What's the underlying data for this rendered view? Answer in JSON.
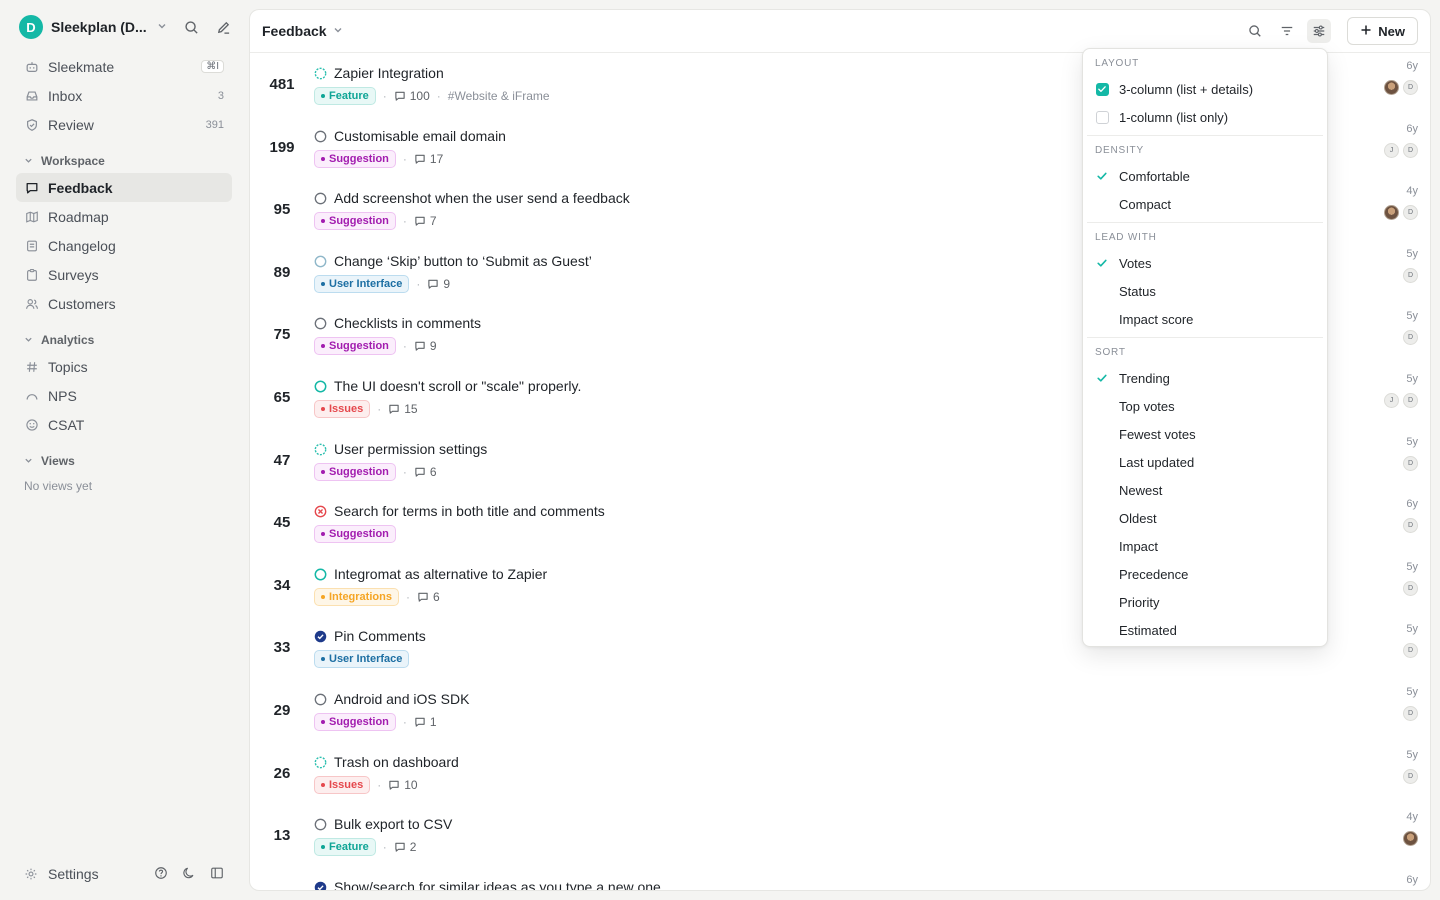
{
  "workspace": {
    "initial": "D",
    "name": "Sleekplan (D..."
  },
  "nav": [
    {
      "label": "Sleekmate",
      "icon": "bot-icon",
      "kbd": "⌘I"
    },
    {
      "label": "Inbox",
      "icon": "inbox-icon",
      "count": "3"
    },
    {
      "label": "Review",
      "icon": "shield-check-icon",
      "count": "391"
    }
  ],
  "sections": {
    "workspace": {
      "label": "Workspace",
      "items": [
        {
          "label": "Feedback",
          "icon": "message-square-icon"
        },
        {
          "label": "Roadmap",
          "icon": "map-icon"
        },
        {
          "label": "Changelog",
          "icon": "layers-icon"
        },
        {
          "label": "Surveys",
          "icon": "clipboard-icon"
        },
        {
          "label": "Customers",
          "icon": "users-icon"
        }
      ]
    },
    "analytics": {
      "label": "Analytics",
      "items": [
        {
          "label": "Topics",
          "icon": "hash-icon"
        },
        {
          "label": "NPS",
          "icon": "gauge-icon"
        },
        {
          "label": "CSAT",
          "icon": "smile-icon"
        }
      ]
    },
    "views": {
      "label": "Views",
      "empty": "No views yet"
    }
  },
  "footer": {
    "settings": "Settings"
  },
  "header": {
    "title": "Feedback",
    "new_label": "New"
  },
  "colors": {
    "accent": "#14b8a6",
    "feature": "#0fb5a3",
    "suggestion": "#b12fc0",
    "ui": "#1f7fb5",
    "issues": "#e5484d",
    "integrations": "#f5a524"
  },
  "rows": [
    {
      "votes": "481",
      "title": "Zapier Integration",
      "status": "open-teal",
      "tag": "Feature",
      "tagType": "feature",
      "comments": "100",
      "topic": "#Website & iFrame",
      "age": "6y",
      "avatars": [
        "photo",
        "D"
      ]
    },
    {
      "votes": "199",
      "title": "Customisable email domain",
      "status": "open-gray",
      "tag": "Suggestion",
      "tagType": "suggestion",
      "comments": "17",
      "age": "6y",
      "avatars": [
        "J",
        "D"
      ]
    },
    {
      "votes": "95",
      "title": "Add screenshot when the user send a feedback",
      "status": "open-gray",
      "tag": "Suggestion",
      "tagType": "suggestion",
      "comments": "7",
      "age": "4y",
      "avatars": [
        "photo",
        "D"
      ]
    },
    {
      "votes": "89",
      "title": "Change ‘Skip’ button to ‘Submit as Guest’",
      "status": "open-light",
      "tag": "User Interface",
      "tagType": "ui",
      "comments": "9",
      "age": "5y",
      "avatars": [
        "D"
      ]
    },
    {
      "votes": "75",
      "title": "Checklists in comments",
      "status": "open-gray",
      "tag": "Suggestion",
      "tagType": "suggestion",
      "comments": "9",
      "age": "5y",
      "avatars": [
        "D"
      ]
    },
    {
      "votes": "65",
      "title": "The UI doesn't scroll or \"scale\" properly.",
      "status": "progress-teal",
      "tag": "Issues",
      "tagType": "issues",
      "comments": "15",
      "age": "5y",
      "avatars": [
        "J",
        "D"
      ]
    },
    {
      "votes": "47",
      "title": "User permission settings",
      "status": "open-teal",
      "tag": "Suggestion",
      "tagType": "suggestion",
      "comments": "6",
      "age": "5y",
      "avatars": [
        "D"
      ]
    },
    {
      "votes": "45",
      "title": "Search for terms in both title and comments",
      "status": "rejected",
      "tag": "Suggestion",
      "tagType": "suggestion",
      "age": "6y",
      "avatars": [
        "D"
      ]
    },
    {
      "votes": "34",
      "title": "Integromat as alternative to Zapier",
      "status": "progress-teal",
      "tag": "Integrations",
      "tagType": "integrations",
      "comments": "6",
      "age": "5y",
      "avatars": [
        "D"
      ]
    },
    {
      "votes": "33",
      "title": "Pin Comments",
      "status": "done",
      "tag": "User Interface",
      "tagType": "ui",
      "age": "5y",
      "avatars": [
        "D"
      ]
    },
    {
      "votes": "29",
      "title": "Android and iOS SDK",
      "status": "open-gray",
      "tag": "Suggestion",
      "tagType": "suggestion",
      "comments": "1",
      "age": "5y",
      "avatars": [
        "D"
      ]
    },
    {
      "votes": "26",
      "title": "Trash on dashboard",
      "status": "open-teal",
      "tag": "Issues",
      "tagType": "issues",
      "comments": "10",
      "age": "5y",
      "avatars": [
        "D"
      ]
    },
    {
      "votes": "13",
      "title": "Bulk export to CSV",
      "status": "open-gray",
      "tag": "Feature",
      "tagType": "feature",
      "comments": "2",
      "age": "4y",
      "avatars": [
        "photo"
      ]
    },
    {
      "votes": "",
      "title": "Show/search for similar ideas as you type a new one",
      "status": "done",
      "age": "6y",
      "avatars": []
    }
  ],
  "dropdown": {
    "layout": {
      "label": "LAYOUT",
      "items": [
        {
          "label": "3-column (list + details)",
          "checked": true
        },
        {
          "label": "1-column (list only)",
          "checked": false
        }
      ]
    },
    "density": {
      "label": "DENSITY",
      "items": [
        {
          "label": "Comfortable",
          "selected": true
        },
        {
          "label": "Compact",
          "selected": false
        }
      ]
    },
    "lead": {
      "label": "LEAD WITH",
      "items": [
        {
          "label": "Votes",
          "selected": true
        },
        {
          "label": "Status",
          "selected": false
        },
        {
          "label": "Impact score",
          "selected": false
        }
      ]
    },
    "sort": {
      "label": "SORT",
      "items": [
        {
          "label": "Trending",
          "selected": true
        },
        {
          "label": "Top votes",
          "selected": false
        },
        {
          "label": "Fewest votes",
          "selected": false
        },
        {
          "label": "Last updated",
          "selected": false
        },
        {
          "label": "Newest",
          "selected": false
        },
        {
          "label": "Oldest",
          "selected": false
        },
        {
          "label": "Impact",
          "selected": false
        },
        {
          "label": "Precedence",
          "selected": false
        },
        {
          "label": "Priority",
          "selected": false
        },
        {
          "label": "Estimated",
          "selected": false
        }
      ]
    }
  }
}
